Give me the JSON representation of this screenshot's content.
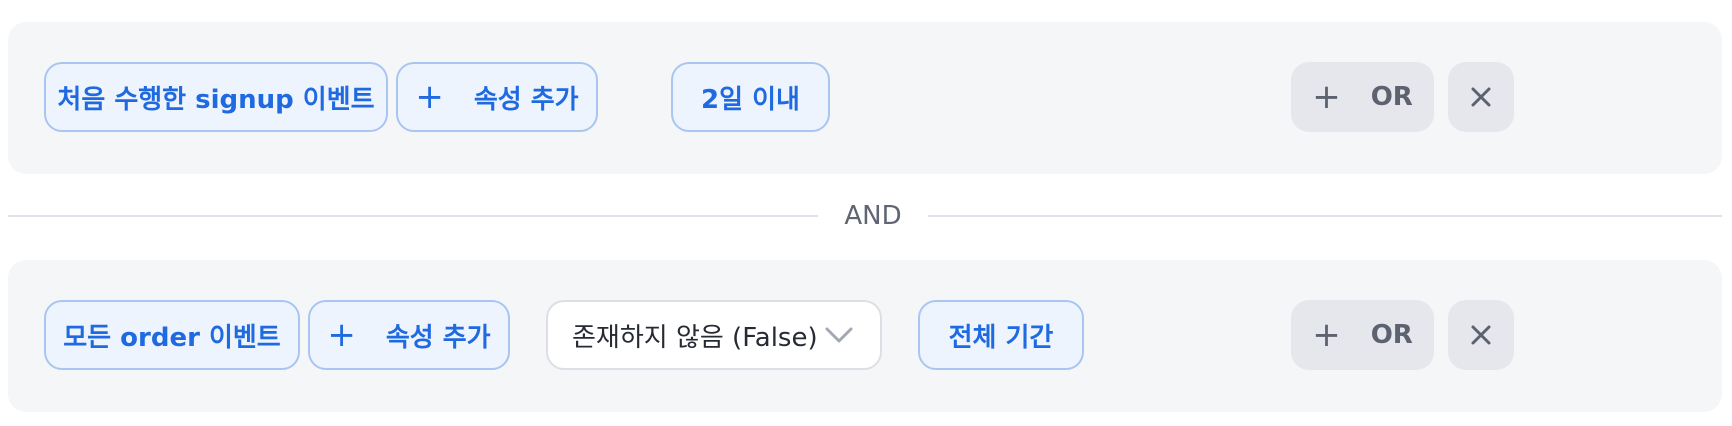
{
  "filters": [
    {
      "event_chip": "처음 수행한 signup 이벤트",
      "add_property": {
        "icon": "+",
        "label": "속성 추가"
      },
      "time_chip": "2일 이내",
      "or_button": {
        "icon": "+",
        "label": "OR"
      },
      "remove_icon": "close-icon"
    },
    {
      "event_chip": "모든 order 이벤트",
      "add_property": {
        "icon": "+",
        "label": "속성 추가"
      },
      "condition_select": "존재하지 않음 (False)",
      "time_chip": "전체 기간",
      "or_button": {
        "icon": "+",
        "label": "OR"
      },
      "remove_icon": "close-icon"
    }
  ],
  "separator": "AND",
  "colors": {
    "accent": "#1f6ae0",
    "chip_border": "#a9c6f2",
    "chip_bg": "#eef4fd",
    "panel_bg": "#f5f6f8",
    "button_bg": "#e5e7ec"
  }
}
